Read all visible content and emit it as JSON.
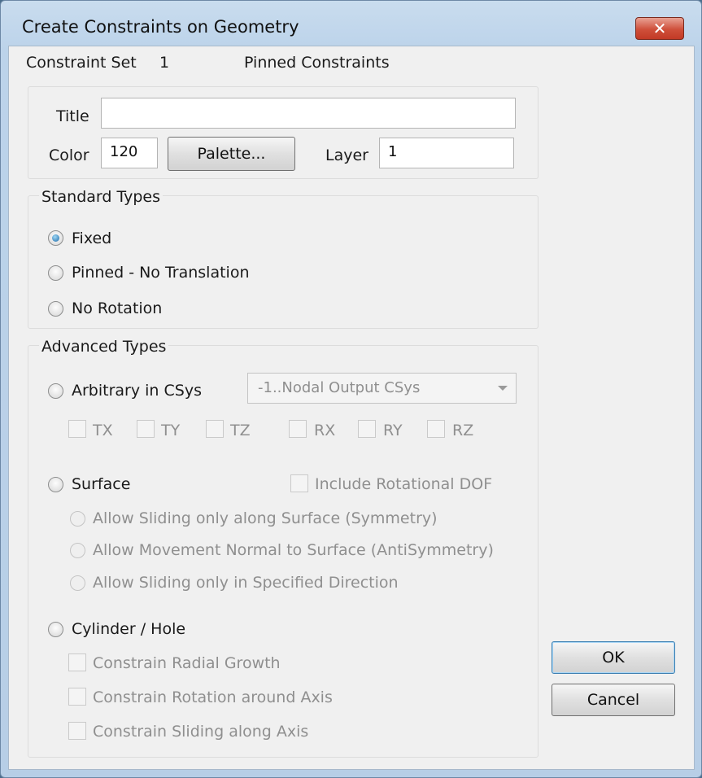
{
  "window": {
    "title": "Create Constraints on Geometry",
    "close_symbol": "✕"
  },
  "header": {
    "constraint_set_label": "Constraint Set",
    "constraint_set_number": "1",
    "constraint_set_name": "Pinned Constraints"
  },
  "props": {
    "title_label": "Title",
    "title_value": "",
    "color_label": "Color",
    "color_value": "120",
    "palette_button": "Palette...",
    "layer_label": "Layer",
    "layer_value": "1"
  },
  "standard": {
    "group_label": "Standard Types",
    "options": [
      "Fixed",
      "Pinned - No Translation",
      "No Rotation"
    ],
    "selected": "Fixed"
  },
  "advanced": {
    "group_label": "Advanced Types",
    "arbitrary_label": "Arbitrary in CSys",
    "csys_value": "-1..Nodal Output CSys",
    "dofs": [
      "TX",
      "TY",
      "TZ",
      "RX",
      "RY",
      "RZ"
    ],
    "surface_label": "Surface",
    "include_rotational": "Include Rotational DOF",
    "surface_options": [
      "Allow Sliding only along Surface (Symmetry)",
      "Allow Movement Normal to Surface (AntiSymmetry)",
      "Allow Sliding only in Specified Direction"
    ],
    "cylinder_label": "Cylinder / Hole",
    "cylinder_options": [
      "Constrain Radial Growth",
      "Constrain Rotation around Axis",
      "Constrain Sliding along Axis"
    ]
  },
  "buttons": {
    "ok": "OK",
    "cancel": "Cancel"
  }
}
